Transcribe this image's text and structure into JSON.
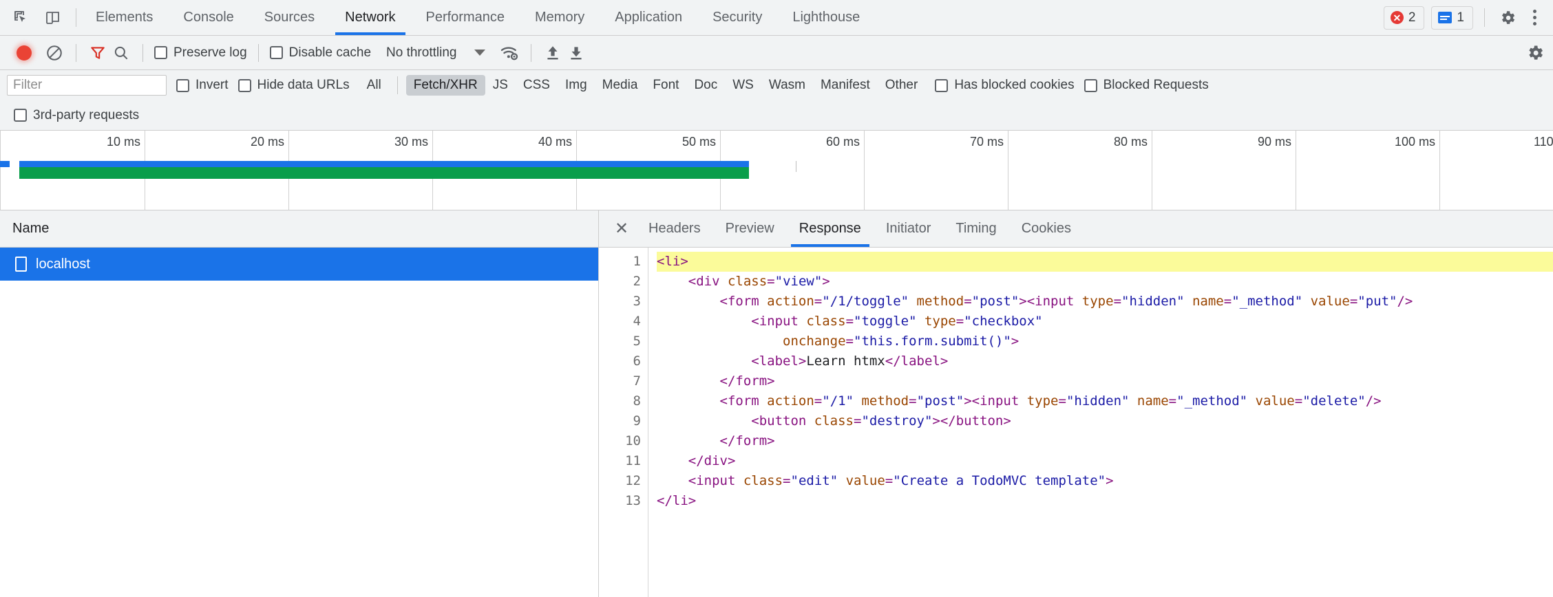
{
  "devtools": {
    "toolbar_icons": [
      {
        "name": "inspect-element-icon",
        "title": "Inspect element"
      },
      {
        "name": "device-toolbar-icon",
        "title": "Toggle device toolbar"
      }
    ],
    "tabs": [
      {
        "label": "Elements",
        "active": false
      },
      {
        "label": "Console",
        "active": false
      },
      {
        "label": "Sources",
        "active": false
      },
      {
        "label": "Network",
        "active": true
      },
      {
        "label": "Performance",
        "active": false
      },
      {
        "label": "Memory",
        "active": false
      },
      {
        "label": "Application",
        "active": false
      },
      {
        "label": "Security",
        "active": false
      },
      {
        "label": "Lighthouse",
        "active": false
      }
    ],
    "status": {
      "error_count": "2",
      "message_count": "1",
      "error_glyph": "✕",
      "settings_icon": "gear-icon",
      "more_icon": "kebab-menu-icon"
    }
  },
  "network_controls": {
    "record_button": "record-button",
    "clear_button": "clear-button",
    "filter_toggle": "filter-funnel-icon",
    "search_button": "search-icon",
    "preserve_log_label": "Preserve log",
    "disable_cache_label": "Disable cache",
    "throttling_value": "No throttling",
    "throttling_caret": "chevron-down-icon",
    "network_conditions_icon": "wifi-settings-icon",
    "import_har_icon": "upload-arrow-icon",
    "export_har_icon": "download-arrow-icon",
    "settings_icon": "gear-icon"
  },
  "filter_bar": {
    "filter_placeholder": "Filter",
    "filter_value": "",
    "invert_label": "Invert",
    "hide_data_urls_label": "Hide data URLs",
    "types": [
      {
        "label": "All",
        "active": false
      },
      {
        "label": "Fetch/XHR",
        "active": true
      },
      {
        "label": "JS",
        "active": false
      },
      {
        "label": "CSS",
        "active": false
      },
      {
        "label": "Img",
        "active": false
      },
      {
        "label": "Media",
        "active": false
      },
      {
        "label": "Font",
        "active": false
      },
      {
        "label": "Doc",
        "active": false
      },
      {
        "label": "WS",
        "active": false
      },
      {
        "label": "Wasm",
        "active": false
      },
      {
        "label": "Manifest",
        "active": false
      },
      {
        "label": "Other",
        "active": false
      }
    ],
    "has_blocked_cookies_label": "Has blocked cookies",
    "blocked_requests_label": "Blocked Requests",
    "third_party_label": "3rd-party requests"
  },
  "overview": {
    "ticks": [
      "10 ms",
      "20 ms",
      "30 ms",
      "40 ms",
      "50 ms",
      "60 ms",
      "70 ms",
      "80 ms",
      "90 ms",
      "100 ms",
      "110"
    ],
    "bar_blue_color": "#1a73e8",
    "bar_green_color": "#0a9e4b"
  },
  "requests": {
    "column_header": "Name",
    "rows": [
      {
        "name": "localhost",
        "icon": "document-icon",
        "selected": true
      }
    ]
  },
  "detail": {
    "close_label": "✕",
    "tabs": [
      {
        "label": "Headers",
        "active": false
      },
      {
        "label": "Preview",
        "active": false
      },
      {
        "label": "Response",
        "active": true
      },
      {
        "label": "Initiator",
        "active": false
      },
      {
        "label": "Timing",
        "active": false
      },
      {
        "label": "Cookies",
        "active": false
      }
    ],
    "response": {
      "highlight_line": 1,
      "lines": [
        {
          "n": "1",
          "indent": 0,
          "tokens": [
            {
              "t": "tag",
              "s": "<li>"
            }
          ]
        },
        {
          "n": "2",
          "indent": 1,
          "tokens": [
            {
              "t": "tag",
              "s": "<div "
            },
            {
              "t": "attr",
              "s": "class"
            },
            {
              "t": "tag",
              "s": "="
            },
            {
              "t": "val",
              "s": "\"view\""
            },
            {
              "t": "tag",
              "s": ">"
            }
          ]
        },
        {
          "n": "3",
          "indent": 2,
          "tokens": [
            {
              "t": "tag",
              "s": "<form "
            },
            {
              "t": "attr",
              "s": "action"
            },
            {
              "t": "tag",
              "s": "="
            },
            {
              "t": "val",
              "s": "\"/1/toggle\""
            },
            {
              "t": "tag",
              "s": " "
            },
            {
              "t": "attr",
              "s": "method"
            },
            {
              "t": "tag",
              "s": "="
            },
            {
              "t": "val",
              "s": "\"post\""
            },
            {
              "t": "tag",
              "s": "><input "
            },
            {
              "t": "attr",
              "s": "type"
            },
            {
              "t": "tag",
              "s": "="
            },
            {
              "t": "val",
              "s": "\"hidden\""
            },
            {
              "t": "tag",
              "s": " "
            },
            {
              "t": "attr",
              "s": "name"
            },
            {
              "t": "tag",
              "s": "="
            },
            {
              "t": "val",
              "s": "\"_method\""
            },
            {
              "t": "tag",
              "s": " "
            },
            {
              "t": "attr",
              "s": "value"
            },
            {
              "t": "tag",
              "s": "="
            },
            {
              "t": "val",
              "s": "\"put\""
            },
            {
              "t": "tag",
              "s": "/>"
            }
          ]
        },
        {
          "n": "4",
          "indent": 3,
          "tokens": [
            {
              "t": "tag",
              "s": "<input "
            },
            {
              "t": "attr",
              "s": "class"
            },
            {
              "t": "tag",
              "s": "="
            },
            {
              "t": "val",
              "s": "\"toggle\""
            },
            {
              "t": "tag",
              "s": " "
            },
            {
              "t": "attr",
              "s": "type"
            },
            {
              "t": "tag",
              "s": "="
            },
            {
              "t": "val",
              "s": "\"checkbox\""
            }
          ]
        },
        {
          "n": "5",
          "indent": 4,
          "tokens": [
            {
              "t": "attr",
              "s": "onchange"
            },
            {
              "t": "tag",
              "s": "="
            },
            {
              "t": "val",
              "s": "\"this.form.submit()\""
            },
            {
              "t": "tag",
              "s": ">"
            }
          ]
        },
        {
          "n": "6",
          "indent": 3,
          "tokens": [
            {
              "t": "tag",
              "s": "<label>"
            },
            {
              "t": "txt",
              "s": "Learn htmx"
            },
            {
              "t": "tag",
              "s": "</label>"
            }
          ]
        },
        {
          "n": "7",
          "indent": 2,
          "tokens": [
            {
              "t": "tag",
              "s": "</form>"
            }
          ]
        },
        {
          "n": "8",
          "indent": 2,
          "tokens": [
            {
              "t": "tag",
              "s": "<form "
            },
            {
              "t": "attr",
              "s": "action"
            },
            {
              "t": "tag",
              "s": "="
            },
            {
              "t": "val",
              "s": "\"/1\""
            },
            {
              "t": "tag",
              "s": " "
            },
            {
              "t": "attr",
              "s": "method"
            },
            {
              "t": "tag",
              "s": "="
            },
            {
              "t": "val",
              "s": "\"post\""
            },
            {
              "t": "tag",
              "s": "><input "
            },
            {
              "t": "attr",
              "s": "type"
            },
            {
              "t": "tag",
              "s": "="
            },
            {
              "t": "val",
              "s": "\"hidden\""
            },
            {
              "t": "tag",
              "s": " "
            },
            {
              "t": "attr",
              "s": "name"
            },
            {
              "t": "tag",
              "s": "="
            },
            {
              "t": "val",
              "s": "\"_method\""
            },
            {
              "t": "tag",
              "s": " "
            },
            {
              "t": "attr",
              "s": "value"
            },
            {
              "t": "tag",
              "s": "="
            },
            {
              "t": "val",
              "s": "\"delete\""
            },
            {
              "t": "tag",
              "s": "/>"
            }
          ]
        },
        {
          "n": "9",
          "indent": 3,
          "tokens": [
            {
              "t": "tag",
              "s": "<button "
            },
            {
              "t": "attr",
              "s": "class"
            },
            {
              "t": "tag",
              "s": "="
            },
            {
              "t": "val",
              "s": "\"destroy\""
            },
            {
              "t": "tag",
              "s": "></button>"
            }
          ]
        },
        {
          "n": "10",
          "indent": 2,
          "tokens": [
            {
              "t": "tag",
              "s": "</form>"
            }
          ]
        },
        {
          "n": "11",
          "indent": 1,
          "tokens": [
            {
              "t": "tag",
              "s": "</div>"
            }
          ]
        },
        {
          "n": "12",
          "indent": 1,
          "tokens": [
            {
              "t": "tag",
              "s": "<input "
            },
            {
              "t": "attr",
              "s": "class"
            },
            {
              "t": "tag",
              "s": "="
            },
            {
              "t": "val",
              "s": "\"edit\""
            },
            {
              "t": "tag",
              "s": " "
            },
            {
              "t": "attr",
              "s": "value"
            },
            {
              "t": "tag",
              "s": "="
            },
            {
              "t": "val",
              "s": "\"Create a TodoMVC template\""
            },
            {
              "t": "tag",
              "s": ">"
            }
          ]
        },
        {
          "n": "13",
          "indent": 0,
          "tokens": [
            {
              "t": "tag",
              "s": "</li>"
            }
          ]
        }
      ]
    }
  }
}
